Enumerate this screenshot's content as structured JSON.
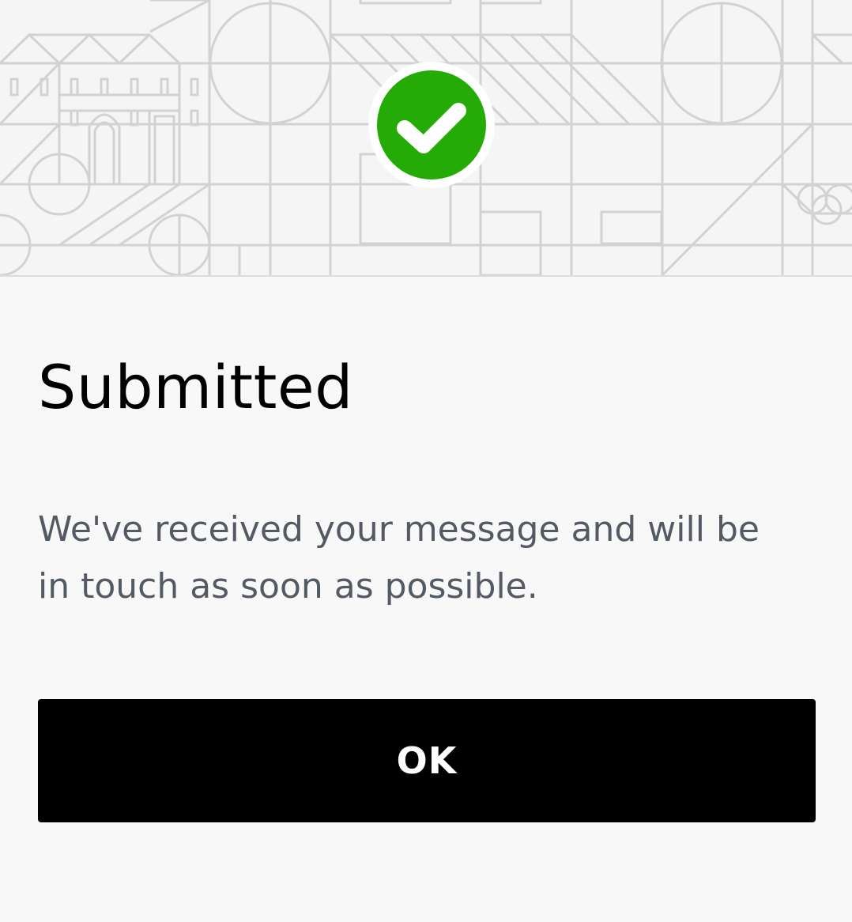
{
  "dialog": {
    "title": "Submitted",
    "message": "We've received your message and will be in touch as soon as possible.",
    "ok_label": "OK"
  },
  "icons": {
    "status": "checkmark-icon",
    "illustration": "city-pattern-illustration"
  },
  "colors": {
    "success": "#24ab05",
    "button_background": "#000000",
    "button_text": "#ffffff",
    "title_text": "#000000",
    "message_text": "#545a63",
    "pattern_lines": "#d2d2d2",
    "background": "#f8f8f8"
  }
}
